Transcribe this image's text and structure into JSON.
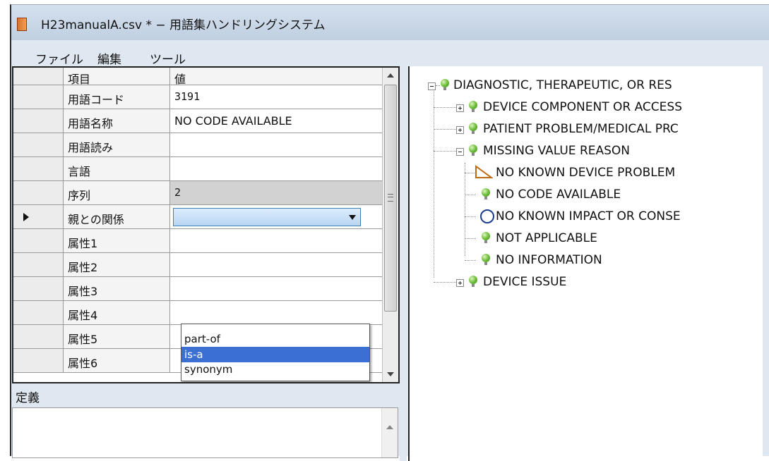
{
  "window": {
    "title": "H23manualA.csv *  −  用語集ハンドリングシステム",
    "icon": "book-icon"
  },
  "menu": [
    {
      "label": "ファイル"
    },
    {
      "label": "編集"
    },
    {
      "label": "ツール"
    }
  ],
  "grid": {
    "headers": {
      "key": "項目",
      "value": "値"
    },
    "rows": [
      {
        "key": "用語コード",
        "value": "3191"
      },
      {
        "key": "用語名称",
        "value": "NO CODE AVAILABLE"
      },
      {
        "key": "用語読み",
        "value": ""
      },
      {
        "key": "言語",
        "value": ""
      },
      {
        "key": "序列",
        "value": "2"
      },
      {
        "key": "親との関係",
        "value": ""
      },
      {
        "key": "属性1",
        "value": ""
      },
      {
        "key": "属性2",
        "value": ""
      },
      {
        "key": "属性3",
        "value": ""
      },
      {
        "key": "属性4",
        "value": ""
      },
      {
        "key": "属性5",
        "value": ""
      },
      {
        "key": "属性6",
        "value": ""
      }
    ],
    "dropdown_options": [
      {
        "label": "part-of"
      },
      {
        "label": "is-a"
      },
      {
        "label": "synonym"
      }
    ]
  },
  "definition": {
    "label": "定義",
    "value": ""
  },
  "tree": {
    "root": "DIAGNOSTIC, THERAPEUTIC, OR RES",
    "children": [
      {
        "label": "DEVICE COMPONENT OR ACCESS"
      },
      {
        "label": "PATIENT PROBLEM/MEDICAL PRC"
      },
      {
        "label": "MISSING VALUE REASON"
      },
      {
        "label": "NO KNOWN DEVICE PROBLEM"
      },
      {
        "label": "NO CODE AVAILABLE"
      },
      {
        "label": "NO KNOWN IMPACT OR CONSE"
      },
      {
        "label": "NOT APPLICABLE"
      },
      {
        "label": "NO INFORMATION"
      },
      {
        "label": "DEVICE ISSUE"
      }
    ]
  },
  "colors": {
    "selection": "#3b6fd1",
    "node_ball": "#6fbf3c",
    "titlebar": "#c8d6e6"
  }
}
